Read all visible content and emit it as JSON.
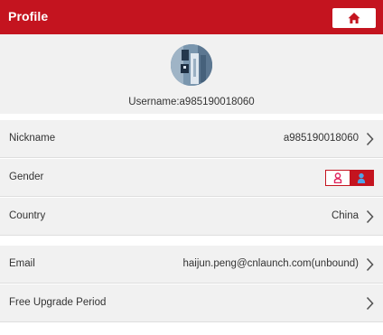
{
  "header": {
    "title": "Profile",
    "home_icon": "home-icon",
    "bar_color": "#c4141f"
  },
  "profile": {
    "avatar_icon": "user-avatar",
    "username": "Username:a985190018060"
  },
  "rows": [
    {
      "label": "Nickname",
      "value": "a985190018060",
      "chevron": true
    },
    {
      "label": "Gender",
      "value": "",
      "selected": "male",
      "options": [
        "female-icon",
        "male-icon"
      ]
    },
    {
      "label": "Country",
      "value": "China",
      "chevron": true
    },
    {
      "label": "Email",
      "value": "haijun.peng@cnlaunch.com(unbound)",
      "chevron": true
    },
    {
      "label": "Free Upgrade Period",
      "value": "",
      "chevron": true
    }
  ]
}
